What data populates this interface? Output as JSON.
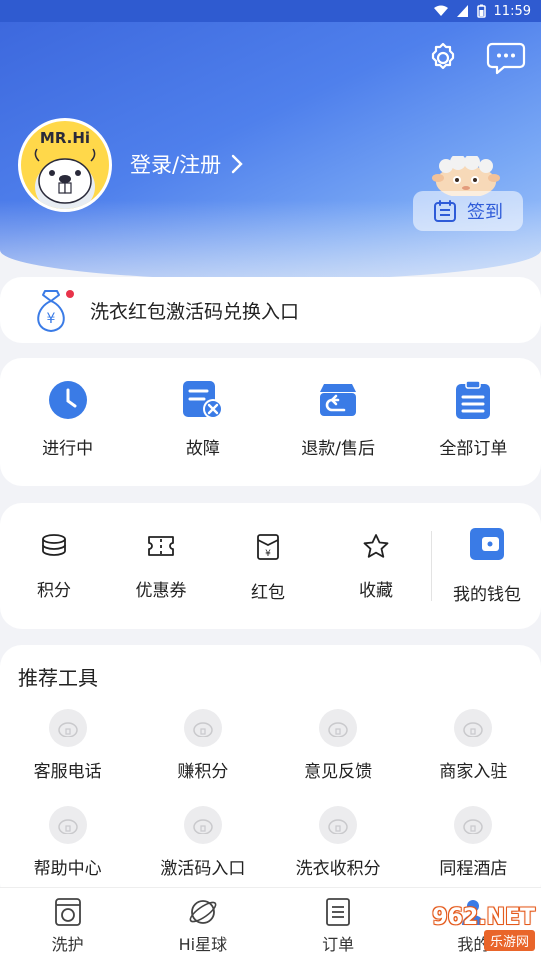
{
  "status_bar": {
    "time": "11:59"
  },
  "header": {
    "avatar_text": "MR.Hi",
    "login_label": "登录/注册",
    "signin_label": "签到",
    "icons": [
      "settings-icon",
      "message-icon"
    ]
  },
  "redpacket": {
    "label": "洗衣红包激活码兑换入口",
    "icon": "money-bag-icon"
  },
  "orders": {
    "items": [
      {
        "label": "进行中",
        "icon": "clock-icon"
      },
      {
        "label": "故障",
        "icon": "fault-icon"
      },
      {
        "label": "退款/售后",
        "icon": "refund-icon"
      },
      {
        "label": "全部订单",
        "icon": "order-list-icon"
      }
    ]
  },
  "wallet": {
    "items": [
      {
        "label": "积分",
        "icon": "coins-icon"
      },
      {
        "label": "优惠券",
        "icon": "coupon-icon"
      },
      {
        "label": "红包",
        "icon": "red-packet-icon"
      },
      {
        "label": "收藏",
        "icon": "star-icon"
      },
      {
        "label": "我的钱包",
        "icon": "wallet-icon"
      }
    ]
  },
  "tools": {
    "title": "推荐工具",
    "items": [
      {
        "label": "客服电话"
      },
      {
        "label": "赚积分"
      },
      {
        "label": "意见反馈"
      },
      {
        "label": "商家入驻"
      },
      {
        "label": "帮助中心"
      },
      {
        "label": "激活码入口"
      },
      {
        "label": "洗衣收积分"
      },
      {
        "label": "同程酒店"
      }
    ]
  },
  "tabbar": {
    "tabs": [
      {
        "label": "洗护",
        "icon": "washer-icon"
      },
      {
        "label": "Hi星球",
        "icon": "planet-icon"
      },
      {
        "label": "订单",
        "icon": "order-icon"
      },
      {
        "label": "我的",
        "icon": "profile-icon"
      }
    ]
  },
  "watermark": {
    "big": "962.NET",
    "small": "乐游网"
  },
  "colors": {
    "accent": "#3b6fe0",
    "header": "#4f80ec",
    "icon_blue": "#3a7be6"
  }
}
